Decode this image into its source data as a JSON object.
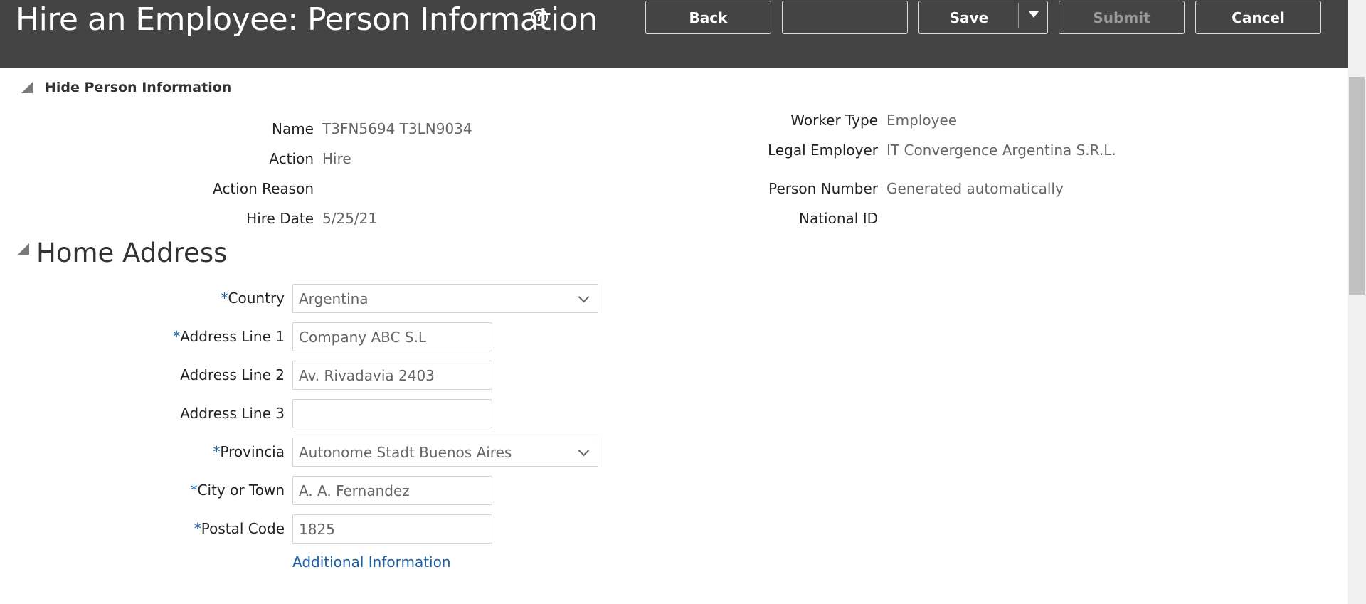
{
  "header": {
    "title": "Hire an Employee: Person Information",
    "buttons": {
      "back": "Back",
      "blank": "",
      "save": "Save",
      "submit": "Submit",
      "cancel": "Cancel"
    }
  },
  "person_section": {
    "toggle_label": "Hide Person Information",
    "left": [
      {
        "label": "Name",
        "value": "T3FN5694 T3LN9034"
      },
      {
        "label": "Action",
        "value": "Hire"
      },
      {
        "label": "Action Reason",
        "value": ""
      },
      {
        "label": "Hire Date",
        "value": "5/25/21"
      }
    ],
    "right": [
      {
        "label": "Worker Type",
        "value": "Employee"
      },
      {
        "label": "Legal Employer",
        "value": "IT Convergence Argentina S.R.L."
      },
      {
        "label": "Person Number",
        "value": "Generated automatically"
      },
      {
        "label": "National ID",
        "value": ""
      }
    ]
  },
  "home_address": {
    "title": "Home Address",
    "required_mark": "*",
    "fields": {
      "country": {
        "label": "Country",
        "value": "Argentina"
      },
      "address1": {
        "label": "Address Line 1",
        "value": "Company ABC S.L"
      },
      "address2": {
        "label": "Address Line 2",
        "value": "Av. Rivadavia 2403"
      },
      "address3": {
        "label": "Address Line 3",
        "value": ""
      },
      "provincia": {
        "label": "Provincia",
        "value": "Autonome Stadt Buenos Aires"
      },
      "city": {
        "label": "City or Town",
        "value": "A. A. Fernandez"
      },
      "postal": {
        "label": "Postal Code",
        "value": "1825"
      }
    },
    "additional_link": "Additional Information"
  },
  "icons": {
    "help": "help-icon",
    "save_menu": "caret-down-icon",
    "collapse": "collapse-triangle-icon",
    "select": "chevron-down-icon"
  },
  "colors": {
    "header_bg": "#444444",
    "required": "#1a5fa6",
    "link": "#1a5fa6"
  }
}
